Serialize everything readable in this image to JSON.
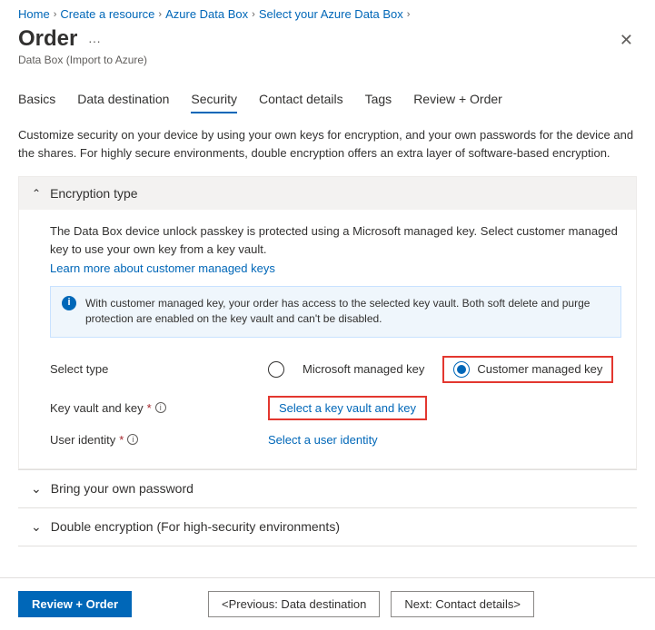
{
  "breadcrumb": [
    "Home",
    "Create a resource",
    "Azure Data Box",
    "Select your Azure Data Box"
  ],
  "title": "Order",
  "subtitle": "Data Box (Import to Azure)",
  "tabs": {
    "items": [
      "Basics",
      "Data destination",
      "Security",
      "Contact details",
      "Tags",
      "Review + Order"
    ],
    "active_index": 2
  },
  "intro": "Customize security on your device by using your own keys for encryption, and your own passwords for the device and the shares. For highly secure environments, double encryption offers an extra layer of software-based encryption.",
  "encryption": {
    "header": "Encryption type",
    "desc": "The Data Box device unlock passkey is protected using a Microsoft managed key. Select customer managed key to use your own key from a key vault.",
    "learn_more": "Learn more about customer managed keys",
    "info_text": "With customer managed key, your order has access to the selected key vault. Both soft delete and purge protection are enabled on the key vault and can't be disabled.",
    "select_type_label": "Select type",
    "radio_ms": "Microsoft managed key",
    "radio_cust": "Customer managed key",
    "selected": "cust",
    "kv_label": "Key vault and key",
    "kv_link": "Select a key vault and key",
    "ident_label": "User identity",
    "ident_link": "Select a user identity"
  },
  "collapsed_sections": {
    "byop": "Bring your own password",
    "double": "Double encryption (For high-security environments)"
  },
  "footer": {
    "review": "Review + Order",
    "prev": "<Previous: Data destination",
    "next": "Next: Contact details>"
  }
}
